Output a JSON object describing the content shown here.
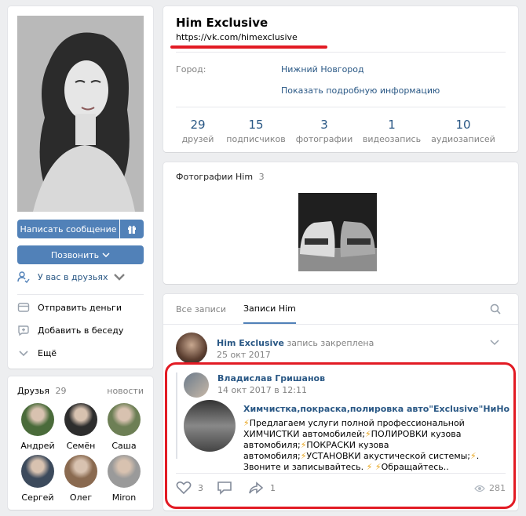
{
  "profile": {
    "name": "Him Exclusive",
    "url": "https://vk.com/himexclusive",
    "city_label": "Город:",
    "city_value": "Нижний Новгород",
    "more_info": "Показать подробную информацию",
    "stats": [
      {
        "value": "29",
        "label": "друзей"
      },
      {
        "value": "15",
        "label": "подписчиков"
      },
      {
        "value": "3",
        "label": "фотографии"
      },
      {
        "value": "1",
        "label": "видеозапись"
      },
      {
        "value": "10",
        "label": "аудиозаписей"
      }
    ]
  },
  "actions": {
    "message": "Написать сообщение",
    "call": "Позвонить",
    "friend_status": "У вас в друзьях",
    "send_money": "Отправить деньги",
    "add_to_chat": "Добавить в беседу",
    "more": "Ещё"
  },
  "friends": {
    "title": "Друзья",
    "count": "29",
    "news": "новости",
    "items": [
      {
        "name": "Андрей",
        "color": "#4a6b3a"
      },
      {
        "name": "Семён",
        "color": "#2d2d2d"
      },
      {
        "name": "Саша",
        "color": "#6d7f55"
      },
      {
        "name": "Сергей",
        "color": "#3c4a5c"
      },
      {
        "name": "Олег",
        "color": "#8a6a50"
      },
      {
        "name": "Miron",
        "color": "#9a9a9a"
      }
    ]
  },
  "photos": {
    "title": "Фотографии Him",
    "count": "3"
  },
  "wall": {
    "tab_all": "Все записи",
    "tab_his": "Записи Him",
    "post": {
      "author": "Him Exclusive",
      "pinned": "запись закреплена",
      "date": "25 окт 2017"
    },
    "repost": {
      "author": "Владислав Гришанов",
      "date": "14 окт 2017 в 12:11",
      "group": "Химчистка,покраска,полировка авто\"Exclusive\"НиНо",
      "text_parts": [
        "Предлагаем услуги полной профессиональной ХИМЧИСТКИ автомобилей;",
        "ПОЛИРОВКИ кузова автомобиля;",
        "ПОКРАСКИ кузова автомобиля;",
        "УСТАНОВКИ акустической системы;",
        ". Звоните и записывайтесь.",
        "Обращайтесь.."
      ]
    },
    "likes": "3",
    "shares": "1",
    "views": "281"
  },
  "colors": {
    "accent": "#5181b8",
    "link": "#2a5885",
    "highlight_red": "#e21b24",
    "bolt": "#e8a317"
  }
}
